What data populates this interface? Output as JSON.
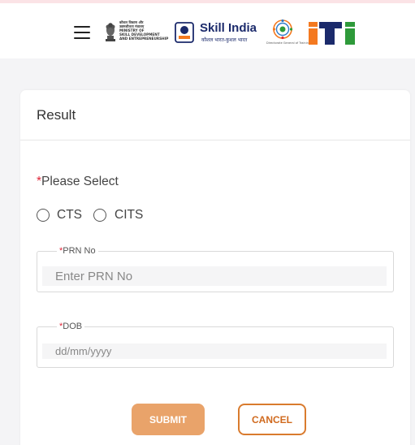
{
  "header": {
    "menu_icon": "hamburger-menu-icon",
    "ministry_logo": {
      "lines": [
        "कौशल विकास और",
        "उद्यमशीलता मंत्रालय",
        "MINISTRY OF",
        "SKILL DEVELOPMENT",
        "AND ENTREPRENEURSHIP"
      ]
    },
    "skill_india": {
      "title": "Skill India",
      "subtitle": "कौशल भारत-कुशल भारत"
    },
    "dget_logo": {
      "caption": "Directorate General of Training"
    },
    "iti_logo": {
      "text": "iti",
      "colors": {
        "orange": "#f47920",
        "navy": "#1b2a6b",
        "green": "#2e9a3a"
      }
    }
  },
  "result": {
    "title": "Result",
    "please_select": {
      "required_mark": "*",
      "label": "Please Select"
    },
    "options": [
      {
        "label": "CTS",
        "selected": false
      },
      {
        "label": "CITS",
        "selected": false
      }
    ],
    "prn": {
      "required_mark": "*",
      "label": "PRN No",
      "placeholder": "Enter PRN No",
      "value": ""
    },
    "dob": {
      "required_mark": "*",
      "label": "DOB",
      "placeholder": "dd/mm/yyyy",
      "value": ""
    },
    "submit_label": "SUBMIT",
    "cancel_label": "CANCEL"
  },
  "colors": {
    "submit_bg": "#e9a36a",
    "cancel_border": "#d97b2e",
    "required": "#e0273a",
    "top_accent": "#fbe3e6"
  }
}
